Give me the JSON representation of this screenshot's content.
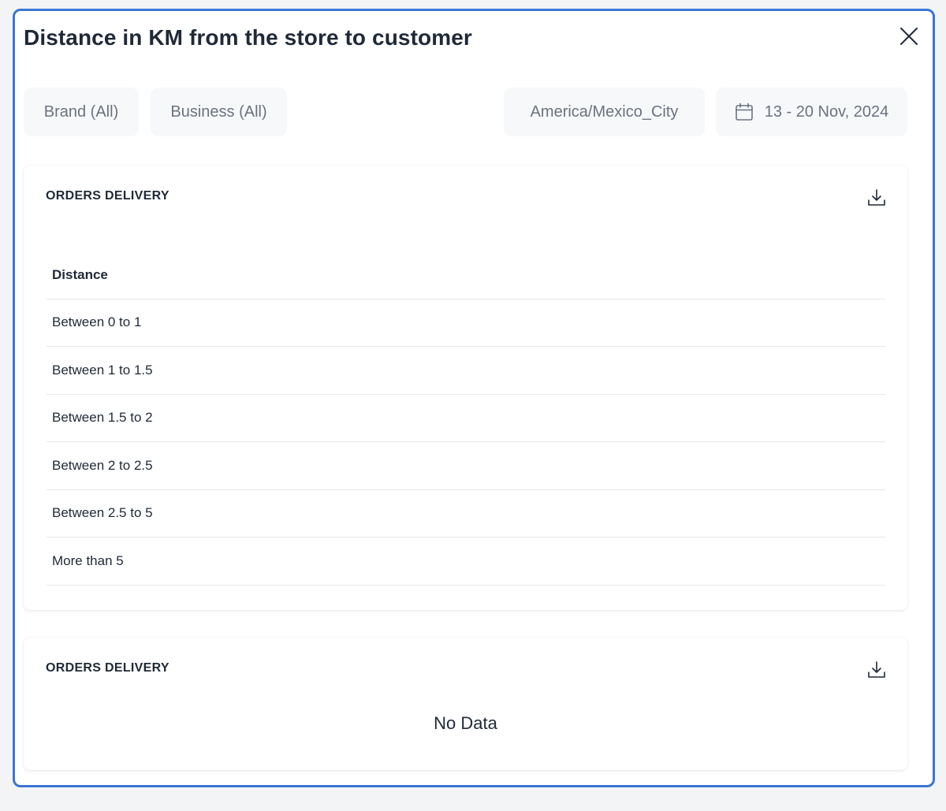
{
  "modal": {
    "title": "Distance in KM from the store to customer"
  },
  "filters": {
    "brand": "Brand (All)",
    "business": "Business (All)",
    "timezone": "America/Mexico_City",
    "date_range": "13 - 20 Nov, 2024"
  },
  "table_card": {
    "title": "ORDERS DELIVERY",
    "column_header": "Distance",
    "rows": [
      "Between 0 to 1",
      "Between 1 to 1.5",
      "Between 1.5 to 2",
      "Between 2 to 2.5",
      "Between 2.5 to 5",
      "More than 5"
    ]
  },
  "empty_card": {
    "title": "ORDERS DELIVERY",
    "empty_text": "No Data"
  },
  "icons": {
    "close": "close-icon",
    "calendar": "calendar-icon",
    "download": "download-icon"
  },
  "colors": {
    "accent_border": "#3a76d4",
    "filter_bg": "#f7f8fa",
    "text_primary": "#1f2937",
    "text_muted": "#6b7280"
  }
}
